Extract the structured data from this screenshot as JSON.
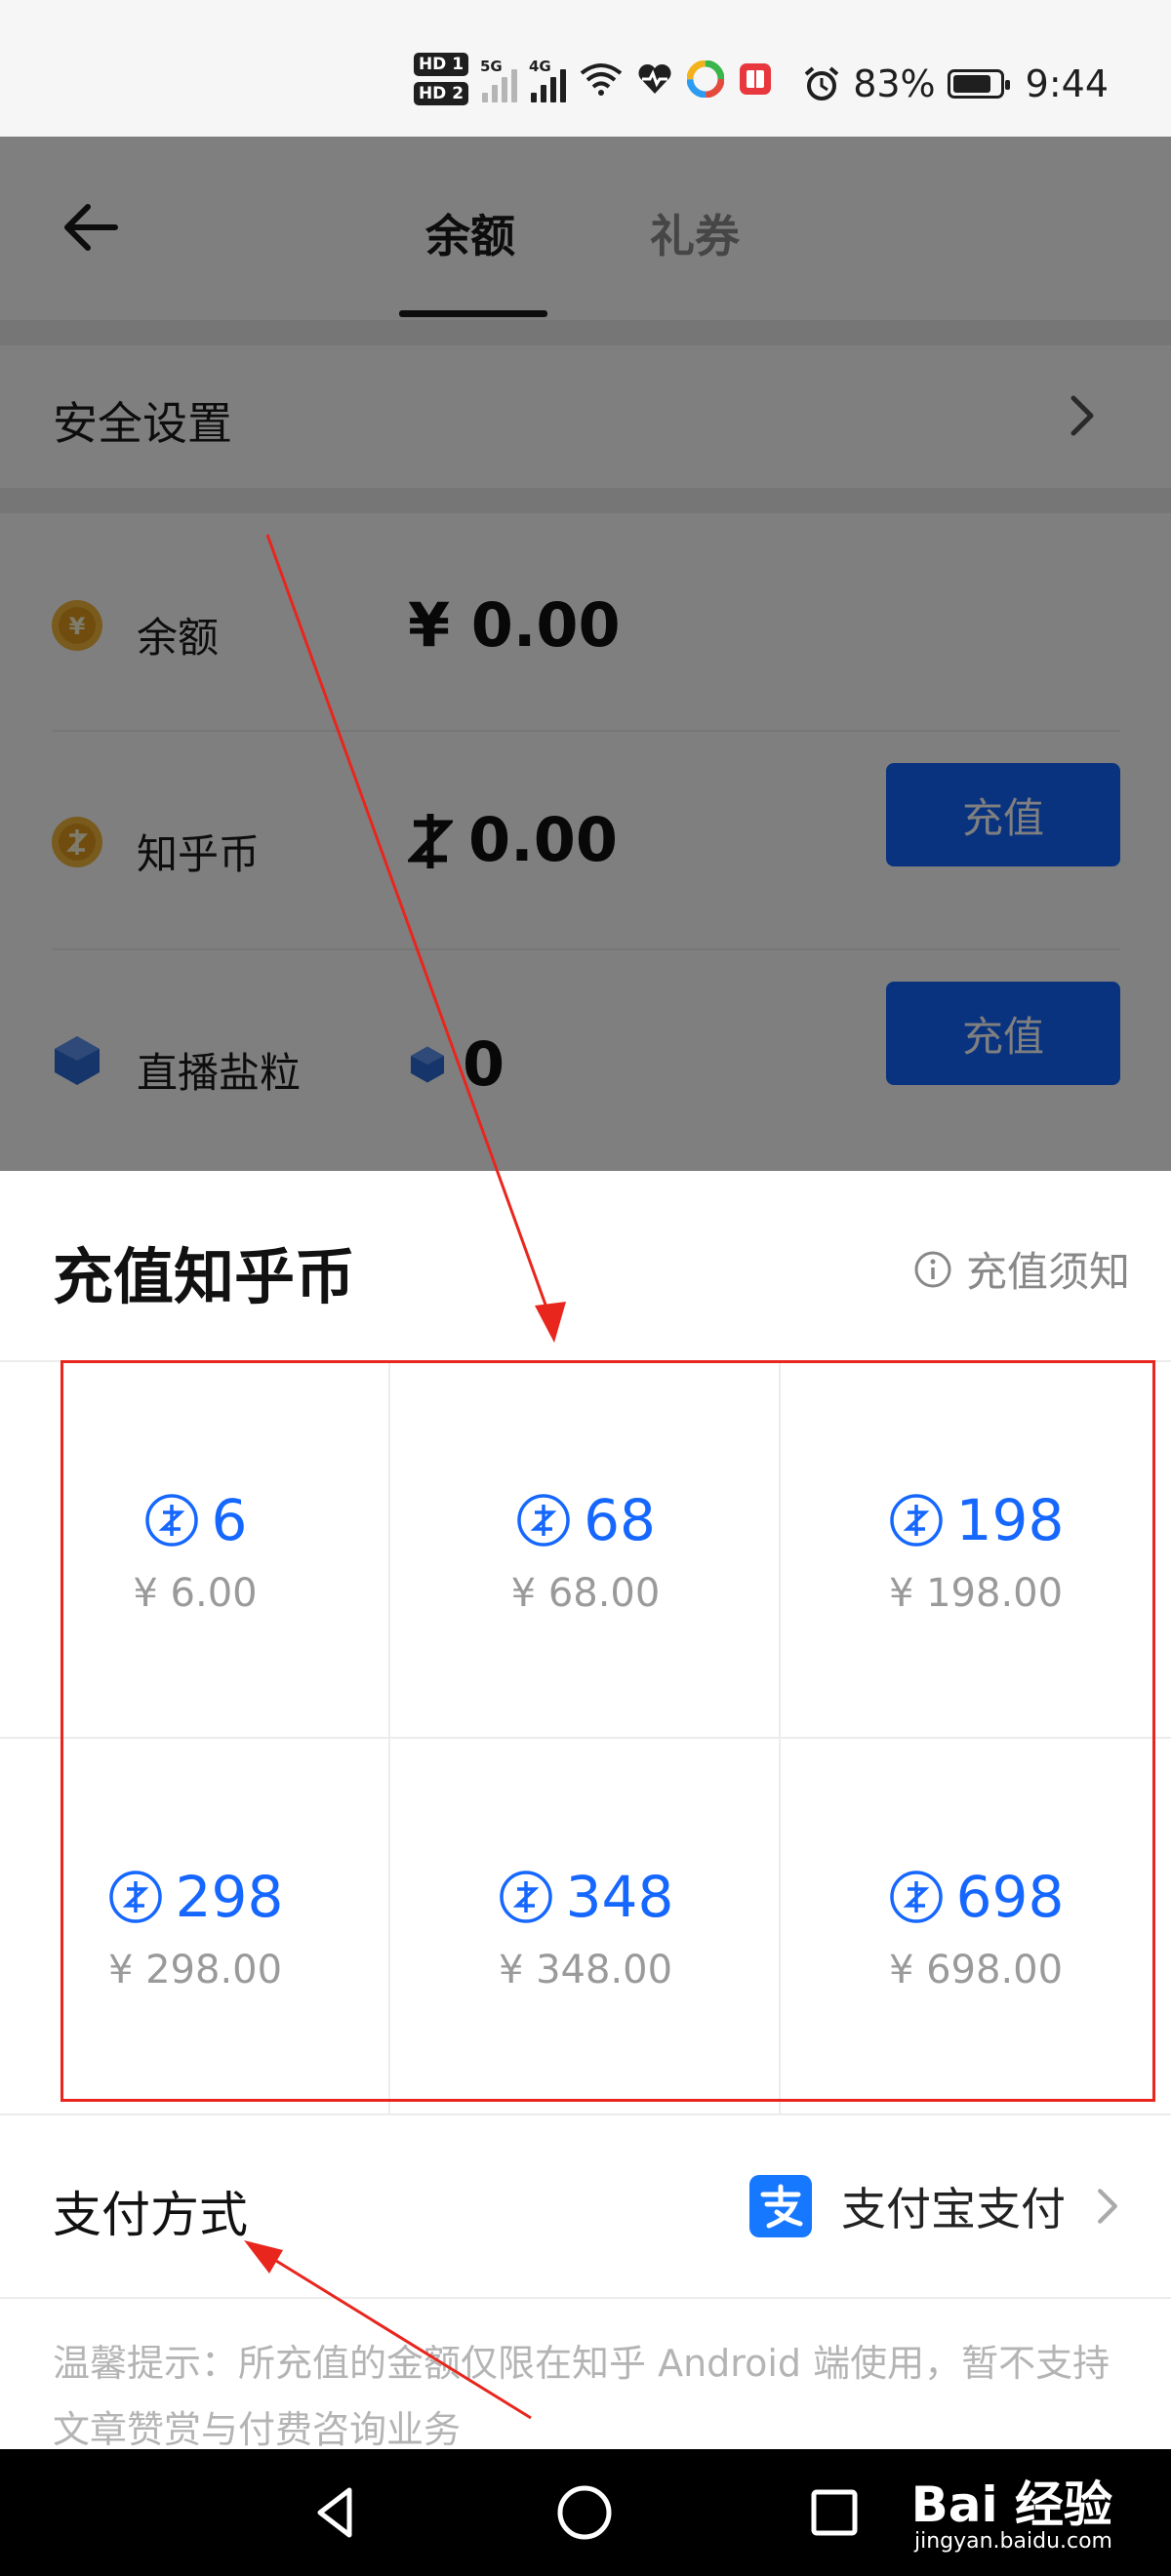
{
  "status_bar": {
    "hd1": "HD 1",
    "hd2": "HD 2",
    "net1": "5G",
    "net2": "4G",
    "battery_percent": "83%",
    "battery_level": 0.83,
    "time": "9:44",
    "icons": [
      "signal-icon",
      "wifi-icon",
      "health-icon",
      "app-icon",
      "book-icon",
      "alarm-icon",
      "battery-icon"
    ]
  },
  "header": {
    "tabs": [
      {
        "label": "余额",
        "active": true
      },
      {
        "label": "礼券",
        "active": false
      }
    ]
  },
  "security": {
    "label": "安全设置"
  },
  "balances": [
    {
      "label": "余额",
      "amount": "¥ 0.00"
    },
    {
      "label": "知乎币",
      "amount": "0.00",
      "button": "充值"
    },
    {
      "label": "直播盐粒",
      "amount": "0",
      "button": "充值"
    }
  ],
  "sheet": {
    "title": "充值知乎币",
    "notice": "充值须知",
    "options": [
      {
        "coins": "6",
        "price": "¥ 6.00"
      },
      {
        "coins": "68",
        "price": "¥ 68.00"
      },
      {
        "coins": "198",
        "price": "¥ 198.00"
      },
      {
        "coins": "298",
        "price": "¥ 298.00"
      },
      {
        "coins": "348",
        "price": "¥ 348.00"
      },
      {
        "coins": "698",
        "price": "¥ 698.00"
      }
    ],
    "payment": {
      "label": "支付方式",
      "method": "支付宝支付"
    },
    "tip": "温馨提示：所充值的金额仅限在知乎 Android 端使用，暂不支持文章赞赏与付费咨询业务"
  },
  "watermark": {
    "brand": "Bai 经验",
    "url": "jingyan.baidu.com"
  },
  "colors": {
    "accent": "#1567ff",
    "annotation": "#e8261e"
  }
}
